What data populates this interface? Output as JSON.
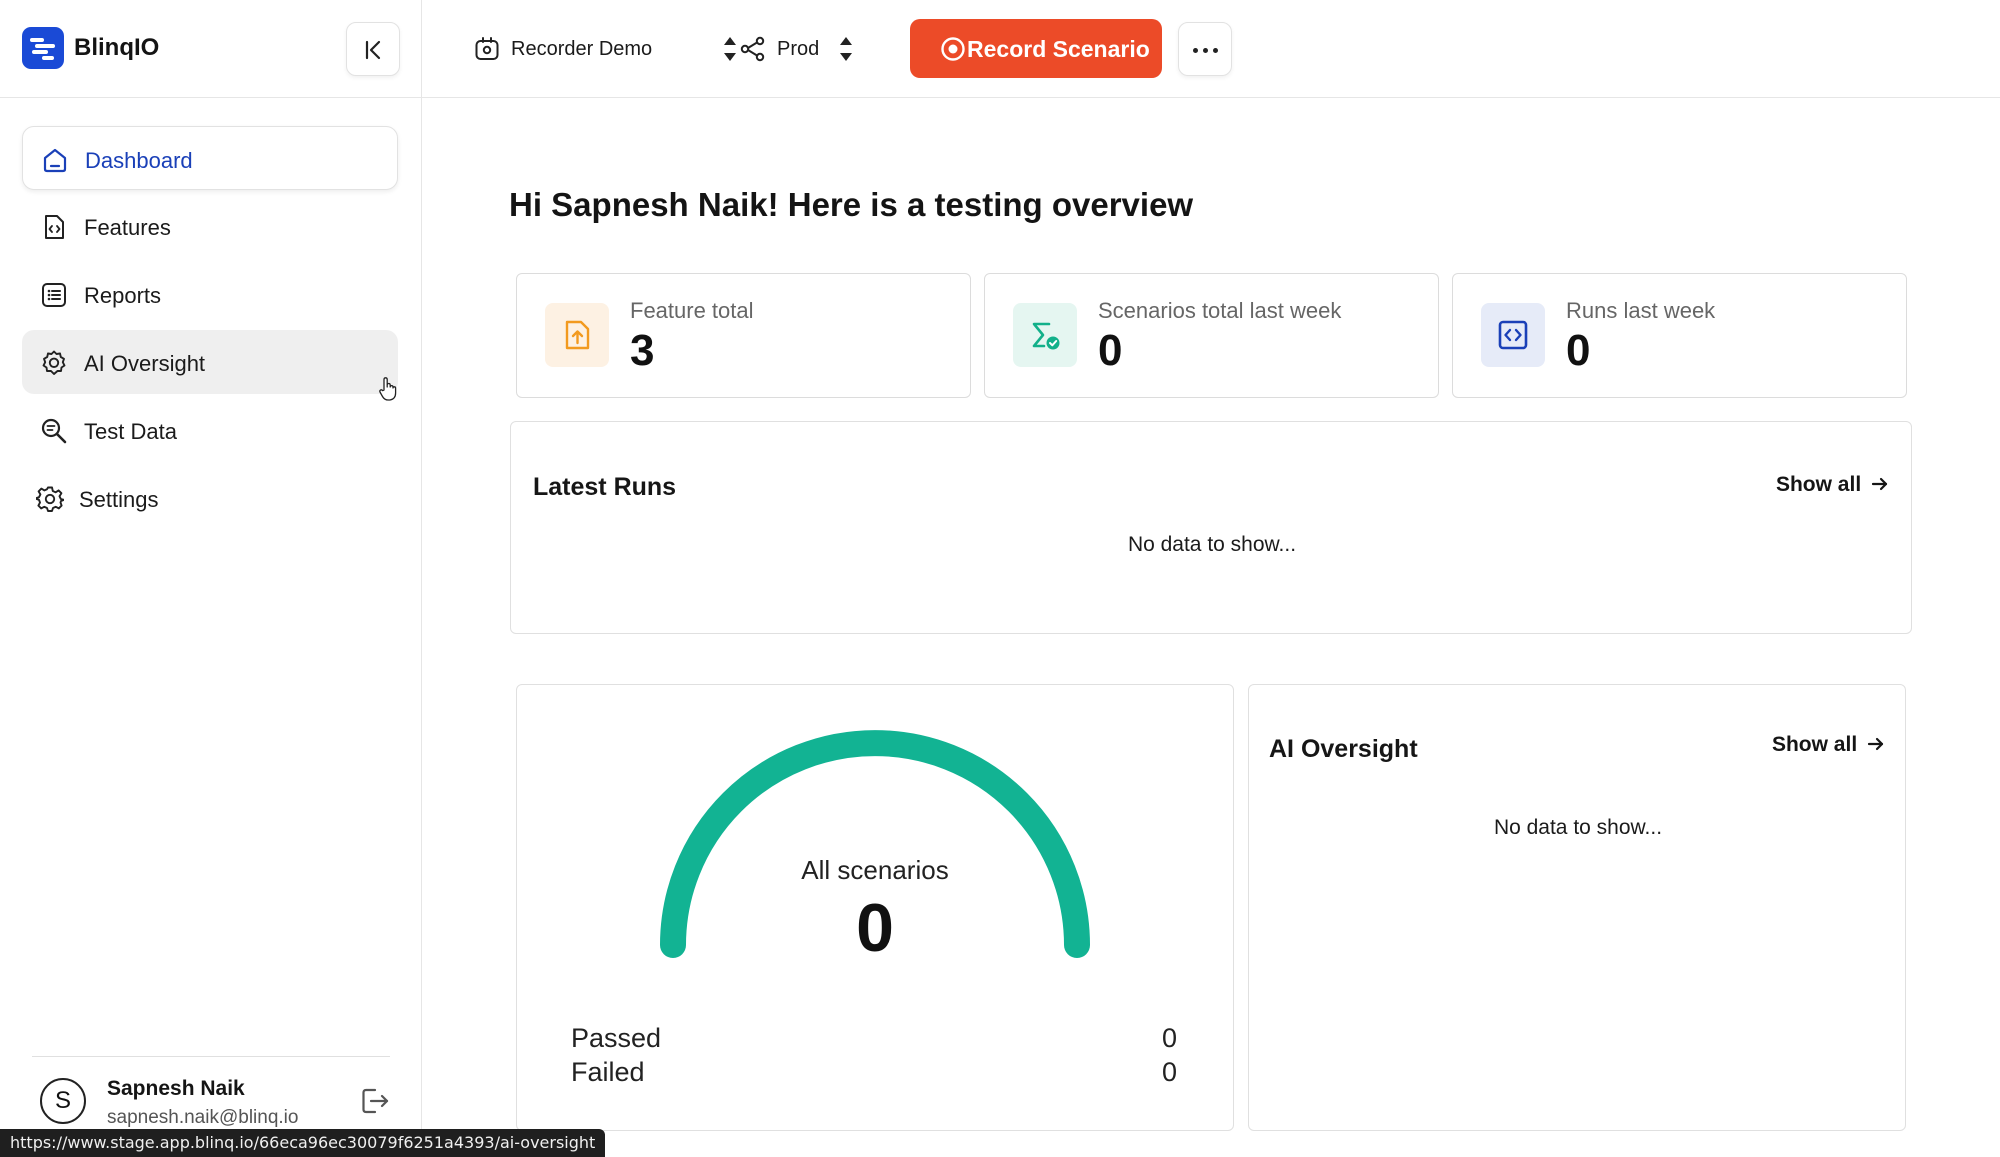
{
  "app": {
    "brand_name": "BlinqIO"
  },
  "sidebar": {
    "items": [
      {
        "label": "Dashboard",
        "icon": "home-icon",
        "state": "active"
      },
      {
        "label": "Features",
        "icon": "code-file-icon"
      },
      {
        "label": "Reports",
        "icon": "list-icon"
      },
      {
        "label": "AI Oversight",
        "icon": "ai-gear-icon",
        "state": "hover"
      },
      {
        "label": "Test Data",
        "icon": "search-data-icon"
      },
      {
        "label": "Settings",
        "icon": "gear-icon"
      }
    ],
    "user": {
      "initial": "S",
      "name": "Sapnesh Naik",
      "email": "sapnesh.naik@blinq.io"
    }
  },
  "topbar": {
    "project_selector": "Recorder Demo",
    "environment_selector": "Prod",
    "record_button": "Record Scenario"
  },
  "main": {
    "greeting": "Hi Sapnesh Naik! Here is a testing overview",
    "stats": [
      {
        "label": "Feature total",
        "value": "3",
        "icon": "file-upload-icon",
        "color": "#f29a1f",
        "bg": "#fdf1e3"
      },
      {
        "label": "Scenarios total last week",
        "value": "0",
        "icon": "sigma-check-icon",
        "color": "#12b08a",
        "bg": "#e5f6f1"
      },
      {
        "label": "Runs last week",
        "value": "0",
        "icon": "code-window-icon",
        "color": "#1a40b8",
        "bg": "#e6ebf8"
      }
    ],
    "latest_runs": {
      "title": "Latest Runs",
      "show_all": "Show all",
      "empty": "No data to show..."
    },
    "scenarios_gauge": {
      "label": "All scenarios",
      "value": "0",
      "color": "#12b393",
      "legend": [
        {
          "label": "Passed",
          "value": "0"
        },
        {
          "label": "Failed",
          "value": "0"
        }
      ]
    },
    "ai_oversight": {
      "title": "AI Oversight",
      "show_all": "Show all",
      "empty": "No data to show..."
    }
  },
  "status_bar": {
    "url": "https://www.stage.app.blinq.io/66eca96ec30079f6251a4393/ai-oversight"
  },
  "colors": {
    "accent": "#1a40b8",
    "record": "#ec4b28",
    "gauge": "#12b393"
  }
}
